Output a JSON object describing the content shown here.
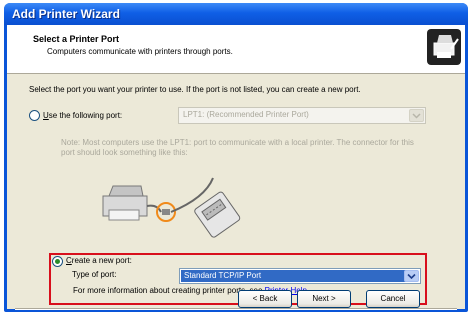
{
  "window": {
    "title": "Add Printer Wizard"
  },
  "header": {
    "title": "Select a Printer Port",
    "subtitle": "Computers communicate with printers through ports.",
    "icon": "printer-port-icon"
  },
  "body": {
    "intro": "Select the port you want your printer to use.  If the port is not listed, you can create a new port.",
    "use_port": {
      "label_prefix": "",
      "label_underlined": "U",
      "label_rest": "se the following port:",
      "selected": false,
      "value": "LPT1: (Recommended Printer Port)"
    },
    "note": "Note: Most computers use the LPT1: port to communicate with a local printer. The connector for this port should look something like this:",
    "create_port": {
      "label_underlined": "C",
      "label_rest": "reate a new port:",
      "selected": true,
      "type_label": "Type of port:",
      "type_value": "Standard TCP/IP Port"
    },
    "more_info": {
      "text": "For more information about creating printer ports, see ",
      "link": "Printer Help",
      "end": "."
    }
  },
  "buttons": {
    "back": "< Back",
    "next": "Next >",
    "cancel": "Cancel"
  },
  "colors": {
    "title_bar": "#0f5fe6",
    "highlight_box": "#d80f1c",
    "selection": "#316ac5"
  }
}
